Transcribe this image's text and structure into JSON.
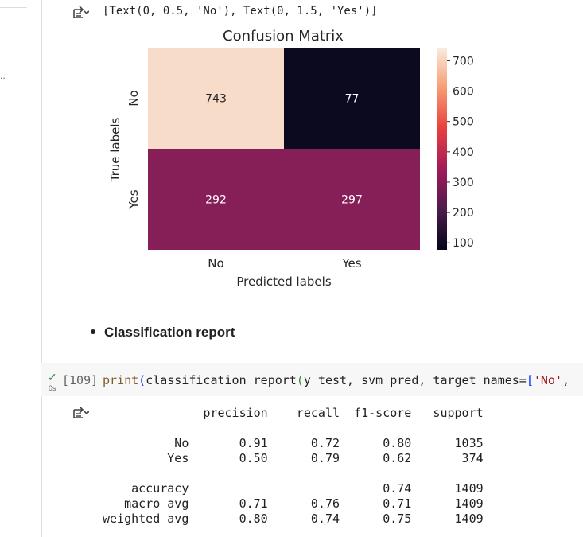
{
  "outputs": {
    "tick_text_repr": "[Text(0, 0.5, 'No'), Text(0, 1.5, 'Yes')]"
  },
  "chart_data": {
    "type": "heatmap",
    "title": "Confusion Matrix",
    "xlabel": "Predicted labels",
    "ylabel": "True labels",
    "x_categories": [
      "No",
      "Yes"
    ],
    "y_categories": [
      "No",
      "Yes"
    ],
    "values": [
      [
        743,
        77
      ],
      [
        292,
        297
      ]
    ],
    "colorbar": {
      "ticks": [
        100,
        200,
        300,
        400,
        500,
        600,
        700
      ],
      "range": [
        77,
        743
      ]
    },
    "cell_colors": [
      [
        "#f6dcc9",
        "#0c0a1f"
      ],
      [
        "#861f57",
        "#861f57"
      ]
    ],
    "cell_text_color": "#ffffff"
  },
  "markdown": {
    "bullet": "Classification report"
  },
  "code_cell": {
    "run_status": "✓",
    "run_time": "0s",
    "exec_count": "[109]",
    "code": {
      "fn": "print",
      "open1": "(",
      "middle": "classification_report",
      "open2": "(",
      "args": "y_test, svm_pred, target_names=",
      "list_open": "[",
      "str_no": "'No'",
      "rest": ","
    }
  },
  "report": {
    "text": "              precision    recall  f1-score   support\n\n          No       0.91      0.72      0.80      1035\n         Yes       0.50      0.79      0.62       374\n\n    accuracy                           0.74      1409\n   macro avg       0.71      0.76      0.71      1409\nweighted avg       0.80      0.74      0.75      1409"
  },
  "icons": {
    "output": "output-toggle-icon"
  },
  "colors": {
    "run_check": "#188038",
    "string": "#a31515",
    "builtin": "#795e26"
  }
}
